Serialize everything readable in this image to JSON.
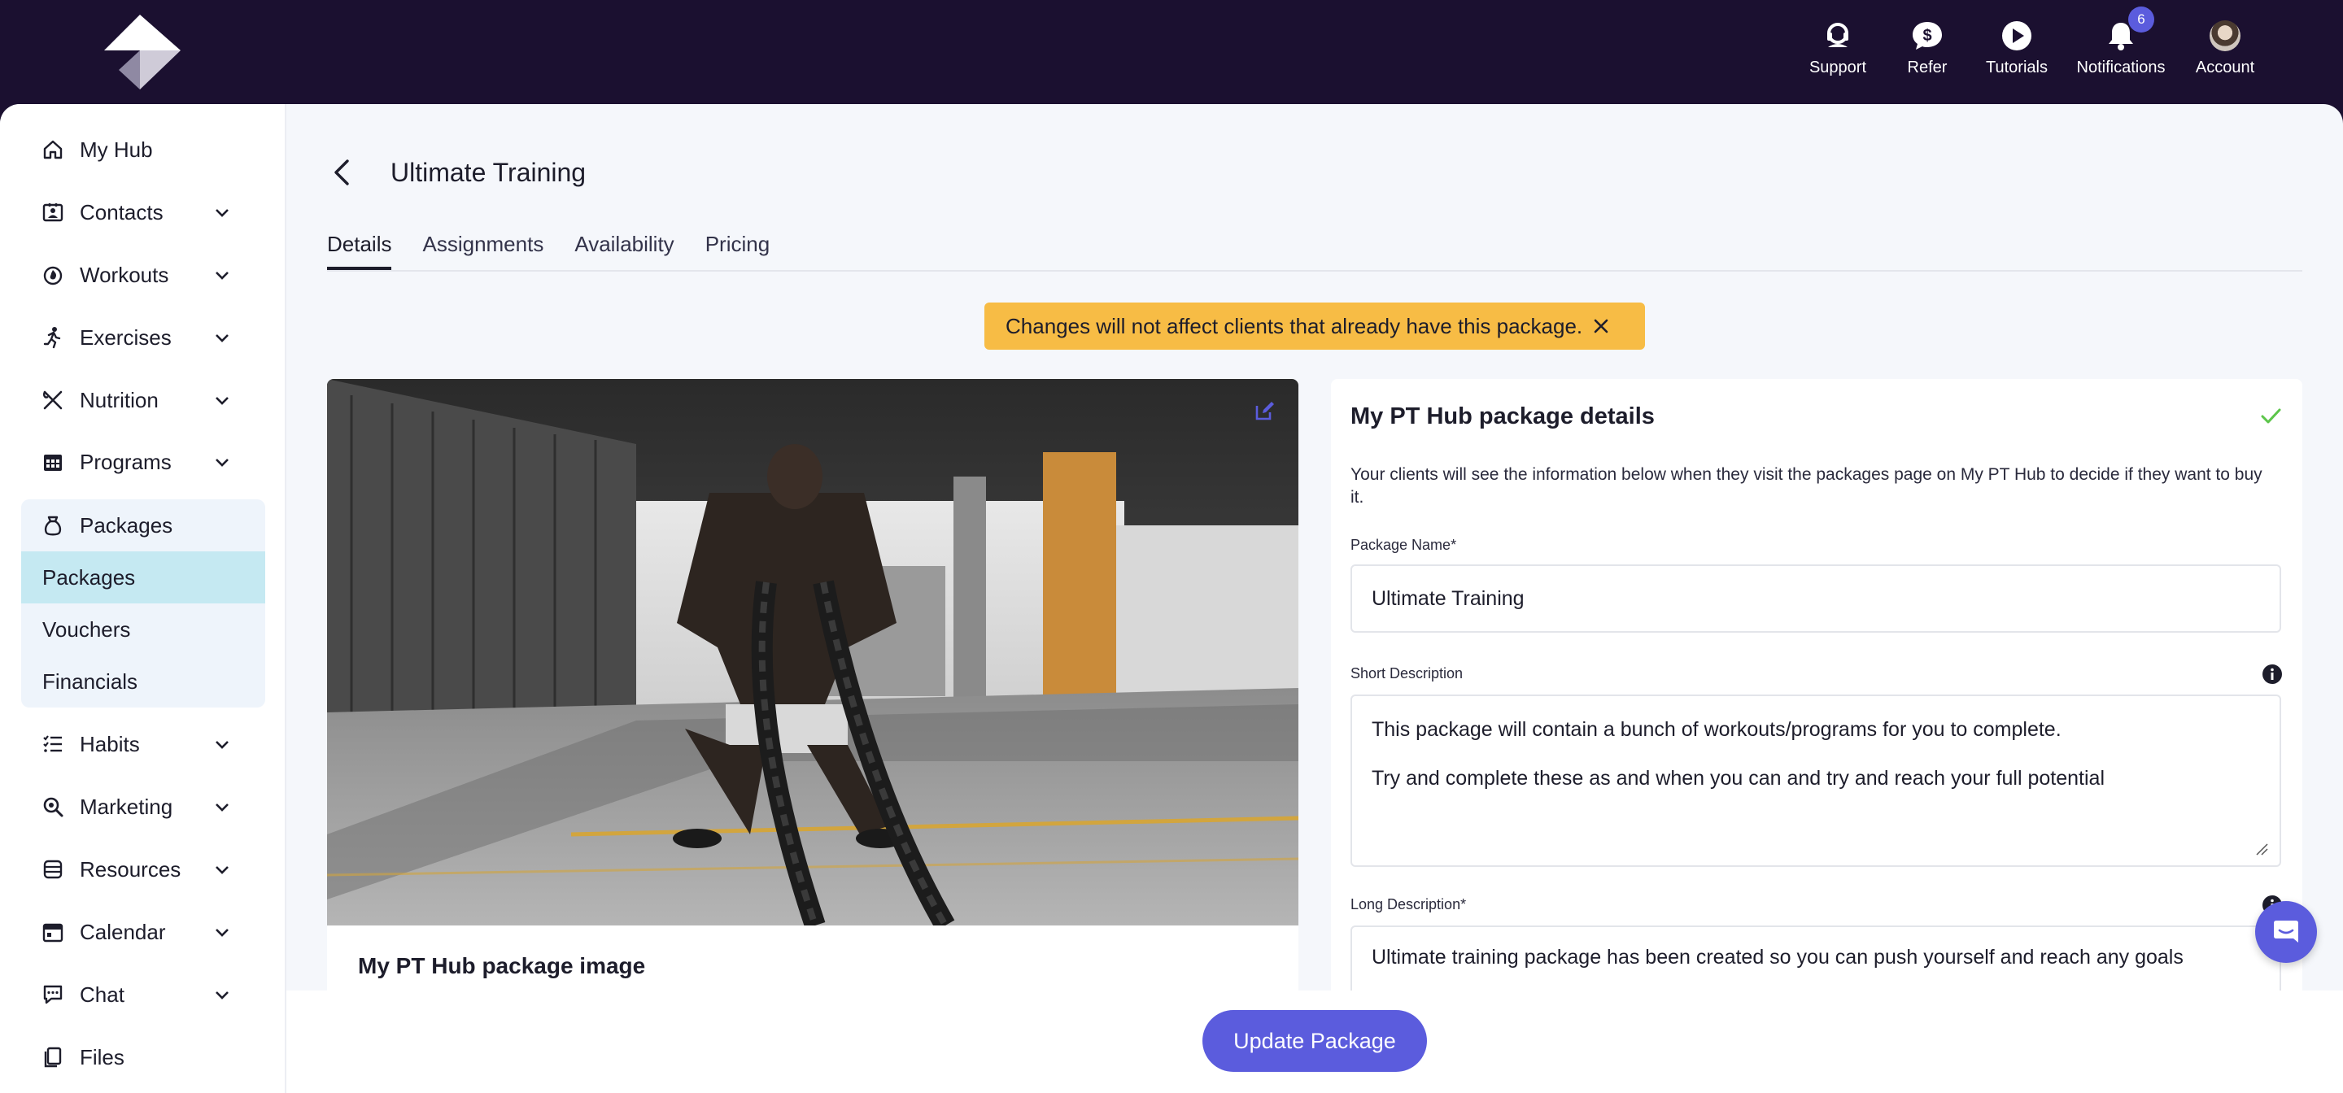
{
  "topbar": {
    "items": [
      {
        "label": "Support",
        "icon": "headset-icon"
      },
      {
        "label": "Refer",
        "icon": "dollar-chat-icon"
      },
      {
        "label": "Tutorials",
        "icon": "play-icon"
      },
      {
        "label": "Notifications",
        "icon": "bell-icon",
        "badge": "6"
      },
      {
        "label": "Account",
        "icon": "avatar"
      }
    ]
  },
  "sidebar": {
    "items": [
      {
        "label": "My Hub",
        "icon": "home-icon"
      },
      {
        "label": "Contacts",
        "icon": "contacts-icon"
      },
      {
        "label": "Workouts",
        "icon": "flame-icon"
      },
      {
        "label": "Exercises",
        "icon": "running-icon"
      },
      {
        "label": "Nutrition",
        "icon": "utensils-icon"
      },
      {
        "label": "Programs",
        "icon": "calendar-grid-icon"
      },
      {
        "label": "Packages",
        "icon": "bag-icon"
      },
      {
        "label": "Habits",
        "icon": "checklist-icon"
      },
      {
        "label": "Marketing",
        "icon": "search-icon"
      },
      {
        "label": "Resources",
        "icon": "database-icon"
      },
      {
        "label": "Calendar",
        "icon": "calendar-icon"
      },
      {
        "label": "Chat",
        "icon": "chat-icon"
      },
      {
        "label": "Files",
        "icon": "files-icon"
      }
    ],
    "sub_items": [
      {
        "label": "Packages",
        "active": true
      },
      {
        "label": "Vouchers"
      },
      {
        "label": "Financials"
      }
    ]
  },
  "page": {
    "title": "Ultimate Training",
    "tabs": [
      "Details",
      "Assignments",
      "Availability",
      "Pricing"
    ]
  },
  "banner": {
    "text": "Changes will not affect clients that already have this package."
  },
  "image_card": {
    "title": "My PT Hub package image"
  },
  "details": {
    "title": "My PT Hub package details",
    "description": "Your clients will see the information below when they visit the packages page on My PT Hub to decide if they want to buy it.",
    "package_name_label": "Package Name*",
    "package_name_value": "Ultimate Training",
    "short_desc_label": "Short Description",
    "short_desc_line1": "This package will contain a bunch of workouts/programs for you to complete.",
    "short_desc_line2": "Try and complete these as and when you can and try and reach your full potential",
    "long_desc_label": "Long Description*",
    "long_desc_value": "Ultimate training package has been created so you can push yourself and reach any goals"
  },
  "actions": {
    "update_label": "Update Package"
  },
  "colors": {
    "topbar": "#1b1030",
    "accent": "#5b5cdd",
    "banner": "#f7bc45",
    "active_sub": "#c5e9f2",
    "check": "#5cc54a"
  }
}
